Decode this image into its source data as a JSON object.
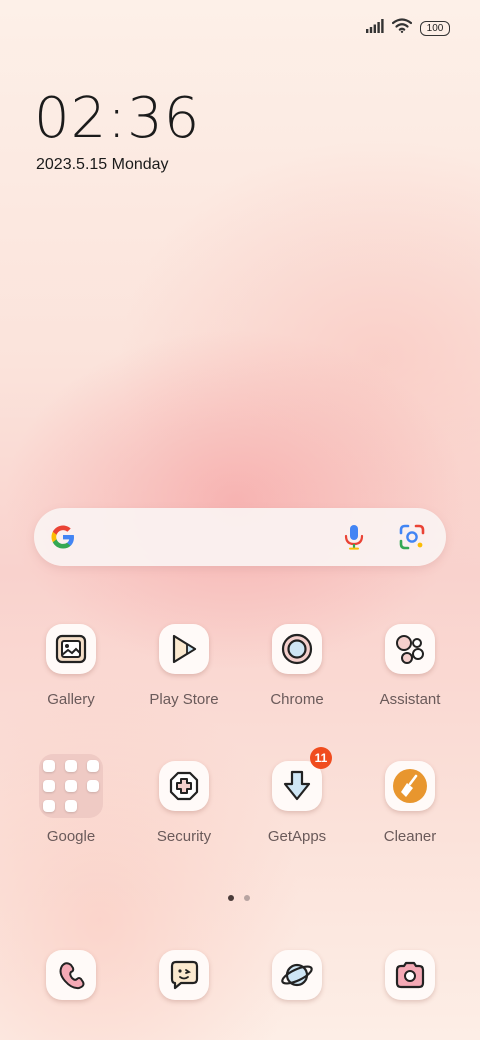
{
  "status_bar": {
    "battery_level": "100"
  },
  "clock": {
    "time": "02:36",
    "date": "2023.5.15 Monday"
  },
  "search_bar": {
    "icons": [
      "google-logo",
      "mic-icon",
      "lens-icon"
    ]
  },
  "home_rows": [
    [
      {
        "label": "Gallery",
        "icon": "gallery-icon"
      },
      {
        "label": "Play Store",
        "icon": "play-store-icon"
      },
      {
        "label": "Chrome",
        "icon": "chrome-icon"
      },
      {
        "label": "Assistant",
        "icon": "assistant-icon"
      }
    ],
    [
      {
        "label": "Google",
        "icon": "folder"
      },
      {
        "label": "Security",
        "icon": "security-icon"
      },
      {
        "label": "GetApps",
        "icon": "getapps-icon",
        "badge": "11"
      },
      {
        "label": "Cleaner",
        "icon": "cleaner-icon"
      }
    ]
  ],
  "page_indicator": {
    "pages": 2,
    "active": 1
  },
  "dock": [
    "phone-icon",
    "messages-icon",
    "browser-icon",
    "camera-icon"
  ],
  "colors": {
    "accent_orange": "#e8962e",
    "badge_red": "#f04c1e",
    "icon_bg": "#fffaf8",
    "label_text": "#6a5a5a"
  }
}
